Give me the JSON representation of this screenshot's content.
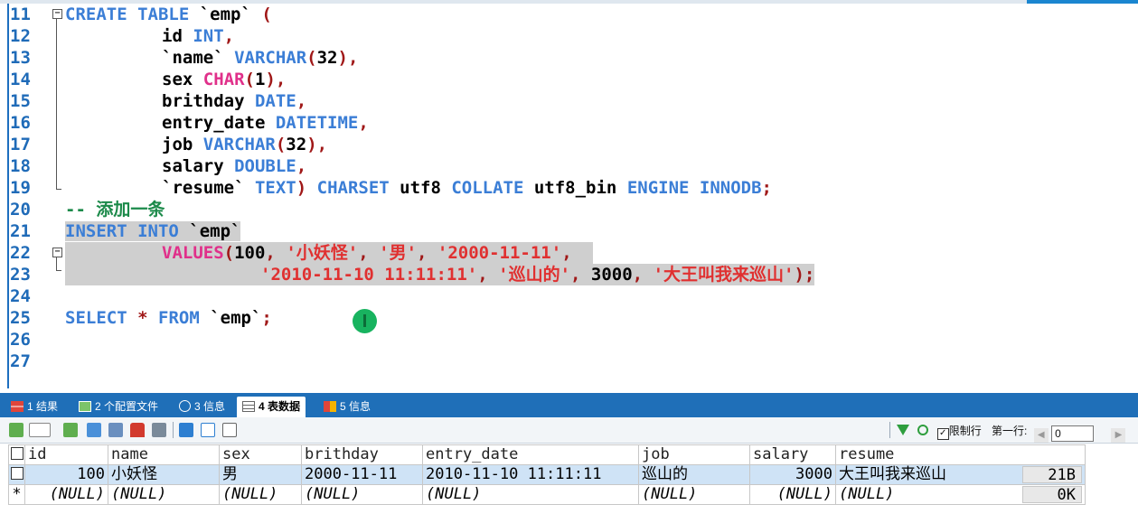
{
  "editor": {
    "lines": [
      {
        "n": "11",
        "t": "CREATE TABLE `emp` ("
      },
      {
        "n": "12",
        "t": "id INT,"
      },
      {
        "n": "13",
        "t": "`name` VARCHAR(32),"
      },
      {
        "n": "14",
        "t": "sex CHAR(1),"
      },
      {
        "n": "15",
        "t": "brithday DATE,"
      },
      {
        "n": "16",
        "t": "entry_date DATETIME,"
      },
      {
        "n": "17",
        "t": "job VARCHAR(32),"
      },
      {
        "n": "18",
        "t": "salary DOUBLE,"
      },
      {
        "n": "19",
        "t": "`resume` TEXT) CHARSET utf8 COLLATE utf8_bin ENGINE INNODB;"
      },
      {
        "n": "20",
        "t": "-- 添加一条"
      },
      {
        "n": "21",
        "t": "INSERT INTO `emp`"
      },
      {
        "n": "22",
        "t": "VALUES(100, '小妖怪', '男', '2000-11-11',"
      },
      {
        "n": "23",
        "t": "'2010-11-10 11:11:11', '巡山的', 3000, '大王叫我来巡山');"
      },
      {
        "n": "24",
        "t": ""
      },
      {
        "n": "25",
        "t": "SELECT * FROM `emp`;"
      },
      {
        "n": "26",
        "t": ""
      },
      {
        "n": "27",
        "t": ""
      }
    ]
  },
  "tabs": [
    {
      "label": "1 结果"
    },
    {
      "label": "2 个配置文件"
    },
    {
      "label": "3 信息"
    },
    {
      "label": "4 表数据"
    },
    {
      "label": "5 信息"
    }
  ],
  "toolbar": {
    "limit_label": "限制行",
    "first_row_label": "第一行:",
    "first_row_value": "0"
  },
  "grid": {
    "columns": [
      "id",
      "name",
      "sex",
      "brithday",
      "entry_date",
      "job",
      "salary",
      "resume"
    ],
    "rows": [
      [
        "100",
        "小妖怪",
        "男",
        "2000-11-11",
        "2010-11-10 11:11:11",
        "巡山的",
        "3000",
        "大王叫我来巡山",
        "21B"
      ],
      [
        "(NULL)",
        "(NULL)",
        "(NULL)",
        "(NULL)",
        "(NULL)",
        "(NULL)",
        "(NULL)",
        "(NULL)",
        "0K"
      ]
    ],
    "new_row_marker": "*"
  },
  "colors": {
    "accent": "#1f6fb8",
    "selection": "#cfcfcf",
    "keyword": "#3b7ed6",
    "string": "#e03030"
  }
}
